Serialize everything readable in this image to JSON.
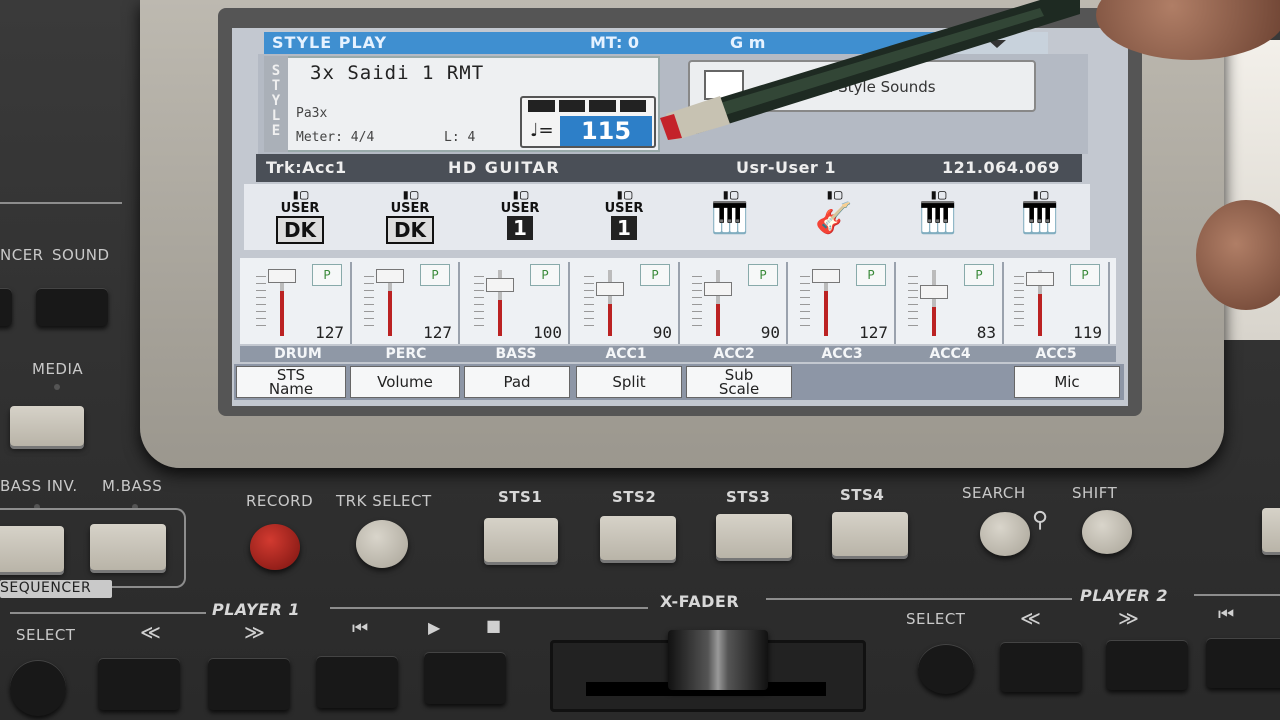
{
  "screen": {
    "header": {
      "mode": "STYLE PLAY",
      "mt": "MT: 0",
      "chord": "G m"
    },
    "style": {
      "vertical_label": "STYLE",
      "name": "3x Saidi 1 RMT",
      "bank": "Pa3x",
      "meter_label": "Meter:  4/4",
      "length_label": "L:  4",
      "tempo_value": "115",
      "tempo_note": "♩="
    },
    "sss_button": {
      "label": "al Style Sounds"
    },
    "track_bar": {
      "track": "Trk:Acc1",
      "sound": "HD GUITAR",
      "bank": "Usr-User 1",
      "sound_id": "121.064.069"
    },
    "slots": [
      {
        "line1": "USER",
        "big": "DK"
      },
      {
        "line1": "USER",
        "big": "DK"
      },
      {
        "line1": "USER",
        "big": "1"
      },
      {
        "line1": "USER",
        "big": "1"
      },
      {
        "line1": "",
        "big": ""
      },
      {
        "line1": "",
        "big": ""
      },
      {
        "line1": "",
        "big": ""
      },
      {
        "line1": "",
        "big": ""
      }
    ],
    "channels": [
      {
        "name": "DRUM",
        "value": "127",
        "level": 1.0
      },
      {
        "name": "PERC",
        "value": "127",
        "level": 1.0
      },
      {
        "name": "BASS",
        "value": "100",
        "level": 0.79
      },
      {
        "name": "ACC1",
        "value": "90",
        "level": 0.71
      },
      {
        "name": "ACC2",
        "value": "90",
        "level": 0.71
      },
      {
        "name": "ACC3",
        "value": "127",
        "level": 1.0
      },
      {
        "name": "ACC4",
        "value": "83",
        "level": 0.65
      },
      {
        "name": "ACC5",
        "value": "119",
        "level": 0.94
      }
    ],
    "p_label": "P",
    "tabs": {
      "sts_name": "STS\nName",
      "volume": "Volume",
      "pad": "Pad",
      "split": "Split",
      "sub_scale": "Sub\nScale",
      "mic": "Mic"
    }
  },
  "panel": {
    "sequencer_sound_left": "NCER",
    "sound": "SOUND",
    "media": "MEDIA",
    "bass_inv": "BASS INV.",
    "m_bass": "M.BASS",
    "sequencer": "SEQUENCER",
    "record": "RECORD",
    "trk_select": "TRK SELECT",
    "sts1": "STS1",
    "sts2": "STS2",
    "sts3": "STS3",
    "sts4": "STS4",
    "search": "SEARCH",
    "shift": "SHIFT",
    "player1": "PLAYER 1",
    "select_left": "SELECT",
    "x_fader": "X-FADER",
    "select_right": "SELECT",
    "player2": "PLAYER 2",
    "rewind_symbol": "≪",
    "forward_symbol": "≫",
    "home_symbol": "⏮",
    "play_symbol": "▶",
    "stop_symbol": "■"
  },
  "colors": {
    "screen_header": "#3f8fd0",
    "tempo_box": "#2d7fc8",
    "record_button": "#a8201c",
    "fader_fill": "#b22222"
  }
}
